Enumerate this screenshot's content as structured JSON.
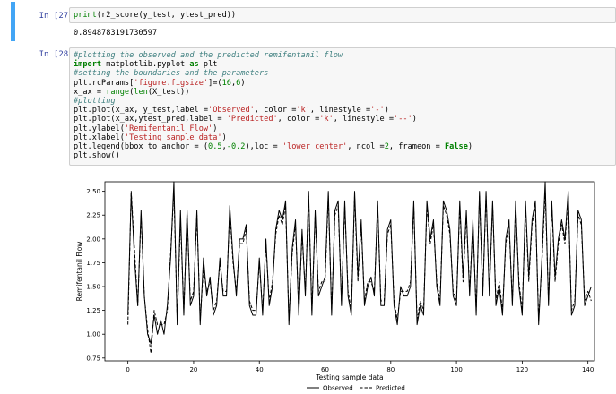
{
  "cells": [
    {
      "prompt": "In [27]:",
      "code_lines": [
        [
          [
            "fn",
            "print"
          ],
          [
            "t",
            "(r2_score(y_test, ytest_pred))"
          ]
        ]
      ],
      "output": "0.8948783191730597"
    },
    {
      "prompt": "In [28]:",
      "code_lines": [
        [
          [
            "cm",
            "#plotting the observed and the predicted remifentanil flow"
          ]
        ],
        [
          [
            "kw",
            "import"
          ],
          [
            "t",
            " matplotlib.pyplot "
          ],
          [
            "kw",
            "as"
          ],
          [
            "t",
            " plt"
          ]
        ],
        [
          [
            "cm",
            "#setting the boundaries and the parameters"
          ]
        ],
        [
          [
            "t",
            "plt.rcParams["
          ],
          [
            "st",
            "'figure.figsize'"
          ],
          [
            "t",
            "]=("
          ],
          [
            "nm",
            "16"
          ],
          [
            "t",
            ","
          ],
          [
            "nm",
            "6"
          ],
          [
            "t",
            ")"
          ]
        ],
        [
          [
            "t",
            "x_ax = "
          ],
          [
            "fn",
            "range"
          ],
          [
            "t",
            "("
          ],
          [
            "fn",
            "len"
          ],
          [
            "t",
            "(X_test))"
          ]
        ],
        [
          [
            "cm",
            "#plotting"
          ]
        ],
        [
          [
            "t",
            "plt.plot(x_ax, y_test,label ="
          ],
          [
            "st",
            "'Observed'"
          ],
          [
            "t",
            ", color ="
          ],
          [
            "st",
            "'k'"
          ],
          [
            "t",
            ", linestyle ="
          ],
          [
            "st",
            "'-'"
          ],
          [
            "t",
            ")"
          ]
        ],
        [
          [
            "t",
            "plt.plot(x_ax,ytest_pred,label = "
          ],
          [
            "st",
            "'Predicted'"
          ],
          [
            "t",
            ", color ="
          ],
          [
            "st",
            "'k'"
          ],
          [
            "t",
            ", linestyle ="
          ],
          [
            "st",
            "'--'"
          ],
          [
            "t",
            ")"
          ]
        ],
        [
          [
            "t",
            "plt.ylabel("
          ],
          [
            "st",
            "'Remifentanil Flow'"
          ],
          [
            "t",
            ")"
          ]
        ],
        [
          [
            "t",
            "plt.xlabel("
          ],
          [
            "st",
            "'Testing sample data'"
          ],
          [
            "t",
            ")"
          ]
        ],
        [
          [
            "t",
            "plt.legend(bbox_to_anchor = ("
          ],
          [
            "nm",
            "0.5"
          ],
          [
            "t",
            ","
          ],
          [
            "nm",
            "-0.2"
          ],
          [
            "t",
            "),loc = "
          ],
          [
            "st",
            "'lower center'"
          ],
          [
            "t",
            ", ncol ="
          ],
          [
            "nm",
            "2"
          ],
          [
            "t",
            ", frameon = "
          ],
          [
            "kw",
            "False"
          ],
          [
            "t",
            ")"
          ]
        ],
        [
          [
            "t",
            "plt.show()"
          ]
        ]
      ]
    }
  ],
  "chart_data": {
    "type": "line",
    "xlabel": "Testing sample data",
    "ylabel": "Remifentanil Flow",
    "xlim": [
      -7,
      142
    ],
    "ylim": [
      0.72,
      2.6
    ],
    "xticks": [
      0,
      20,
      40,
      60,
      80,
      100,
      120,
      140
    ],
    "yticks": [
      0.75,
      1.0,
      1.25,
      1.5,
      1.75,
      2.0,
      2.25,
      2.5
    ],
    "ytick_labels": [
      "0.75",
      "1.00",
      "1.25",
      "1.50",
      "1.75",
      "2.00",
      "2.25",
      "2.50"
    ],
    "grid": false,
    "legend_placement": "bottom-center",
    "series": [
      {
        "name": "Observed",
        "color": "#000000",
        "linestyle": "solid",
        "values": [
          1.2,
          2.48,
          1.8,
          1.3,
          2.3,
          1.4,
          1.0,
          0.9,
          1.2,
          1.0,
          1.15,
          1.0,
          1.3,
          1.8,
          2.6,
          1.1,
          2.3,
          1.2,
          2.3,
          1.3,
          1.4,
          2.3,
          1.1,
          1.8,
          1.4,
          1.6,
          1.2,
          1.3,
          1.8,
          1.4,
          1.4,
          2.35,
          1.8,
          1.4,
          2.0,
          2.0,
          2.15,
          1.3,
          1.2,
          1.2,
          1.8,
          1.2,
          2.0,
          1.3,
          1.5,
          2.1,
          2.3,
          2.2,
          2.4,
          1.1,
          1.9,
          2.2,
          1.2,
          2.1,
          1.4,
          2.5,
          1.2,
          2.3,
          1.4,
          1.5,
          1.6,
          2.5,
          1.2,
          2.3,
          2.4,
          1.3,
          2.4,
          1.4,
          1.2,
          2.5,
          1.6,
          2.2,
          1.3,
          1.5,
          1.6,
          1.4,
          2.4,
          1.3,
          1.3,
          2.1,
          2.2,
          1.3,
          1.1,
          1.5,
          1.4,
          1.4,
          1.5,
          2.4,
          1.1,
          1.3,
          1.2,
          2.4,
          2.0,
          2.2,
          1.5,
          1.3,
          2.4,
          2.3,
          2.1,
          1.4,
          1.3,
          2.4,
          1.6,
          2.3,
          1.4,
          2.2,
          1.2,
          2.5,
          1.4,
          2.5,
          1.4,
          2.4,
          1.3,
          1.5,
          1.2,
          2.0,
          2.2,
          1.3,
          2.4,
          1.5,
          1.2,
          2.4,
          1.6,
          2.2,
          2.4,
          1.1,
          1.8,
          2.6,
          1.3,
          2.4,
          1.6,
          2.0,
          2.2,
          2.0,
          2.5,
          1.2,
          1.3,
          2.3,
          2.2,
          1.3,
          1.4,
          1.5
        ]
      },
      {
        "name": "Predicted",
        "color": "#000000",
        "linestyle": "dashed",
        "values": [
          1.1,
          2.5,
          1.9,
          1.3,
          2.25,
          1.4,
          1.05,
          0.8,
          1.25,
          1.1,
          1.1,
          1.1,
          1.25,
          1.85,
          2.5,
          1.15,
          2.2,
          1.25,
          2.25,
          1.35,
          1.45,
          2.25,
          1.15,
          1.7,
          1.45,
          1.55,
          1.25,
          1.35,
          1.75,
          1.45,
          1.45,
          2.3,
          1.75,
          1.45,
          1.95,
          1.95,
          2.1,
          1.35,
          1.25,
          1.25,
          1.75,
          1.25,
          1.95,
          1.35,
          1.55,
          2.05,
          2.25,
          2.15,
          2.35,
          1.15,
          1.85,
          2.15,
          1.25,
          2.05,
          1.45,
          2.45,
          1.25,
          2.25,
          1.45,
          1.55,
          1.55,
          2.45,
          1.25,
          2.25,
          2.35,
          1.35,
          2.35,
          1.45,
          1.25,
          2.45,
          1.55,
          2.15,
          1.35,
          1.55,
          1.55,
          1.45,
          2.35,
          1.35,
          1.35,
          2.05,
          2.15,
          1.35,
          1.15,
          1.45,
          1.45,
          1.45,
          1.55,
          2.35,
          1.15,
          1.35,
          1.25,
          2.35,
          1.95,
          2.15,
          1.55,
          1.35,
          2.35,
          2.25,
          2.05,
          1.45,
          1.35,
          2.35,
          1.55,
          2.25,
          1.45,
          2.15,
          1.25,
          2.45,
          1.45,
          2.45,
          1.45,
          2.35,
          1.35,
          1.55,
          1.25,
          1.95,
          2.15,
          1.35,
          2.35,
          1.55,
          1.25,
          2.35,
          1.55,
          2.15,
          2.35,
          1.15,
          1.75,
          2.5,
          1.35,
          2.35,
          1.55,
          1.95,
          2.15,
          1.95,
          2.45,
          1.25,
          1.35,
          2.25,
          2.15,
          1.35,
          1.45,
          1.35
        ]
      }
    ]
  }
}
